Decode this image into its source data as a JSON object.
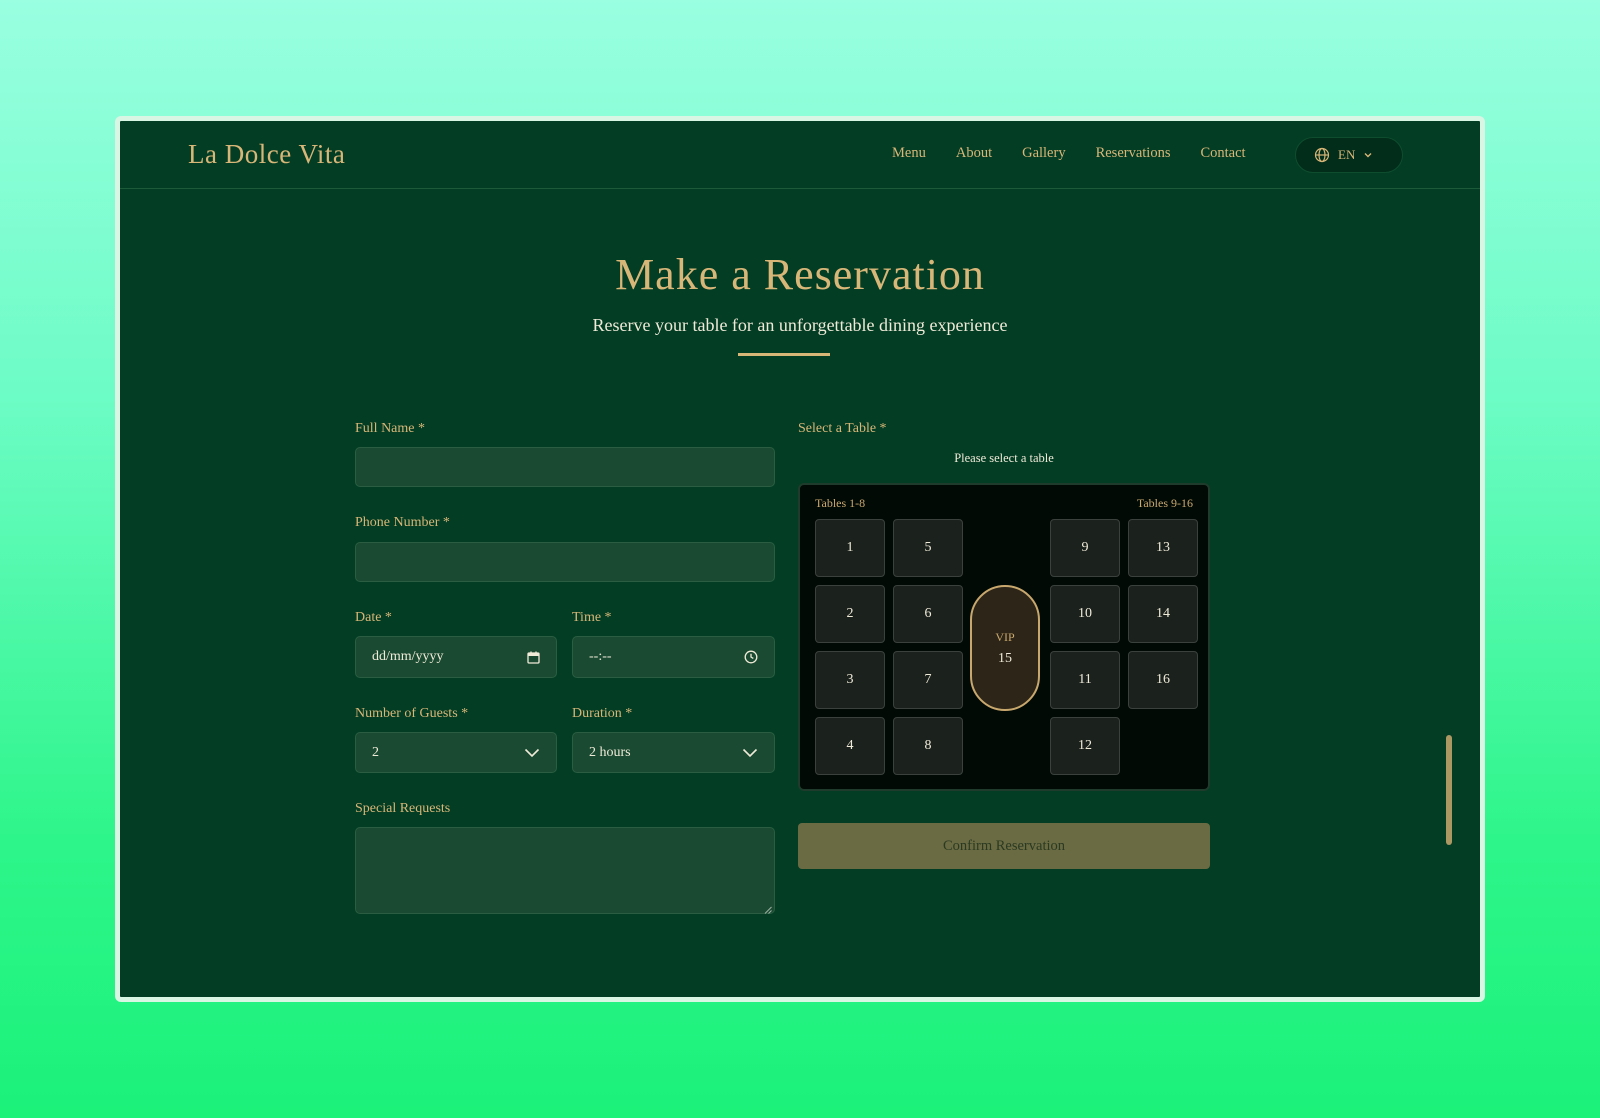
{
  "header": {
    "brand": "La Dolce Vita",
    "nav": [
      "Menu",
      "About",
      "Gallery",
      "Reservations",
      "Contact"
    ],
    "language": "EN",
    "language_icon": "globe-icon"
  },
  "hero": {
    "title": "Make a Reservation",
    "subtitle": "Reserve your table for an unforgettable dining experience"
  },
  "form": {
    "full_name_label": "Full Name *",
    "full_name_value": "",
    "phone_label": "Phone Number *",
    "phone_value": "",
    "date_label": "Date *",
    "date_value": "dd/mm/yyyy",
    "time_label": "Time *",
    "time_value": "--:--",
    "guests_label": "Number of Guests *",
    "guests_value": "2",
    "duration_label": "Duration *",
    "duration_value": "2 hours",
    "requests_label": "Special Requests",
    "requests_value": ""
  },
  "table_select": {
    "label": "Select a Table *",
    "hint": "Please select a table",
    "left_group": "Tables 1-8",
    "right_group": "Tables 9-16",
    "tables": [
      "1",
      "2",
      "3",
      "4",
      "5",
      "6",
      "7",
      "8",
      "9",
      "10",
      "11",
      "12",
      "13",
      "14",
      "16"
    ],
    "vip_tag": "VIP",
    "vip_number": "15"
  },
  "actions": {
    "confirm_label": "Confirm Reservation"
  },
  "colors": {
    "background": "#023d24",
    "gold": "#d8b678",
    "field": "#1a4b32",
    "map": "#020a06",
    "button": "#6b6b43"
  }
}
